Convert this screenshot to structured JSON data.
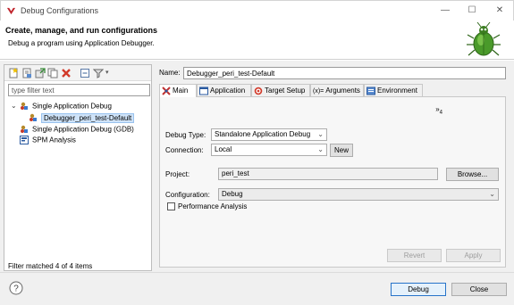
{
  "window": {
    "title": "Debug Configurations",
    "minimize_glyph": "—",
    "maximize_glyph": "☐",
    "close_glyph": "✕"
  },
  "header": {
    "title": "Create, manage, and run configurations",
    "subtitle": "Debug a program using Application Debugger."
  },
  "left": {
    "filter_placeholder": "type filter text",
    "tree": [
      {
        "label": "Single Application Debug",
        "expanded": true,
        "level": 0
      },
      {
        "label": "Debugger_peri_test-Default",
        "selected": true,
        "level": 1
      },
      {
        "label": "Single Application Debug (GDB)",
        "level": 0
      },
      {
        "label": "SPM Analysis",
        "level": 0
      }
    ],
    "status": "Filter matched 4 of 4 items"
  },
  "right": {
    "name_label": "Name:",
    "name_value": "Debugger_peri_test-Default",
    "tabs": [
      {
        "label": "Main",
        "active": true
      },
      {
        "label": "Application"
      },
      {
        "label": "Target Setup"
      },
      {
        "label": "Arguments"
      },
      {
        "label": "Environment"
      }
    ],
    "overflow": "»",
    "overflow_count": "4",
    "debug_type_label": "Debug Type:",
    "debug_type_value": "Standalone Application Debug",
    "connection_label": "Connection:",
    "connection_value": "Local",
    "new_button": "New",
    "project_label": "Project:",
    "project_value": "peri_test",
    "browse_button": "Browse...",
    "configuration_label": "Configuration:",
    "configuration_value": "Debug",
    "performance_label": "Performance Analysis",
    "performance_checked": false,
    "revert_button": "Revert",
    "apply_button": "Apply"
  },
  "footer": {
    "debug_button": "Debug",
    "close_button": "Close"
  },
  "colors": {
    "accent": "#2673c9",
    "selection": "#cfe3f8",
    "delete_red": "#d23a2a",
    "bug_green": "#4a9a2a"
  }
}
